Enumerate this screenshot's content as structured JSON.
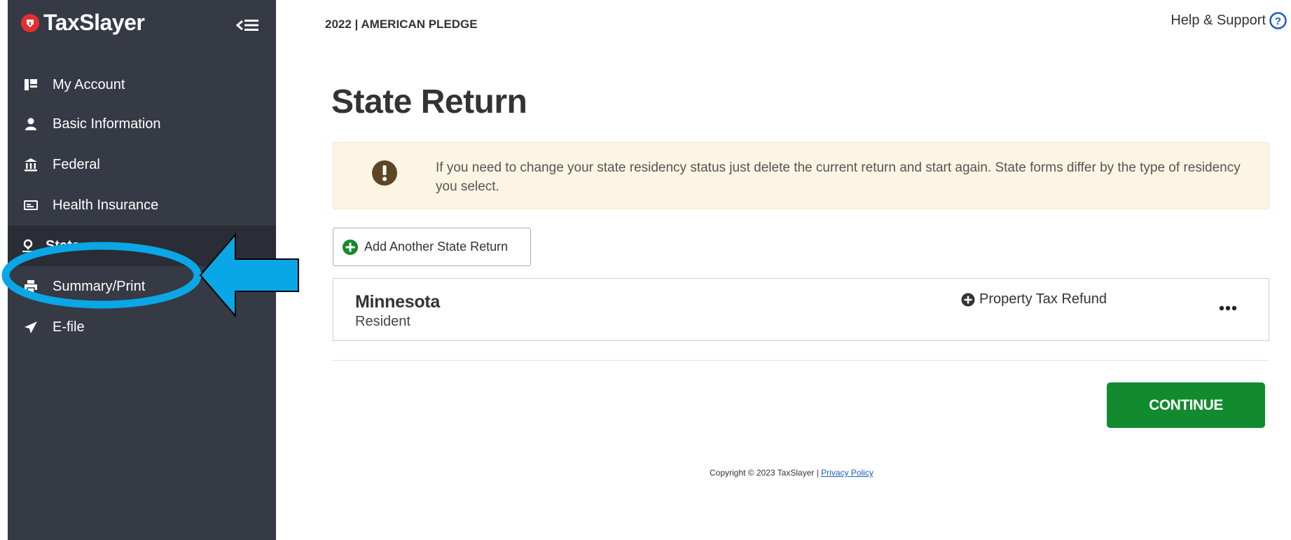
{
  "brand": {
    "name": "TaxSlayer"
  },
  "sidebar": {
    "items": [
      {
        "label": "My Account",
        "icon": "account-icon"
      },
      {
        "label": "Basic Information",
        "icon": "person-icon"
      },
      {
        "label": "Federal",
        "icon": "bank-icon"
      },
      {
        "label": "Health Insurance",
        "icon": "card-icon"
      },
      {
        "label": "State",
        "icon": "location-pin-icon",
        "active": true
      },
      {
        "label": "Summary/Print",
        "icon": "printer-icon"
      },
      {
        "label": "E-file",
        "icon": "send-icon"
      }
    ]
  },
  "header": {
    "title": "2022 | AMERICAN PLEDGE",
    "help_label": "Help & Support"
  },
  "main": {
    "page_title": "State Return",
    "notice": "If you need to change your state residency status just delete the current return and start again. State forms differ by the type of residency you select.",
    "add_button_label": "Add Another State Return",
    "state_card": {
      "name": "Minnesota",
      "residency": "Resident",
      "extra_form_label": "Property Tax Refund"
    },
    "continue_label": "CONTINUE"
  },
  "footer": {
    "copyright": "Copyright © 2023 TaxSlayer | ",
    "privacy_label": "Privacy Policy"
  },
  "colors": {
    "sidebar_bg": "#363a44",
    "brand_red": "#e3302f",
    "continue_green": "#128a2e",
    "notice_bg": "#fdf5e3",
    "annotation_blue": "#0aa7e6"
  }
}
